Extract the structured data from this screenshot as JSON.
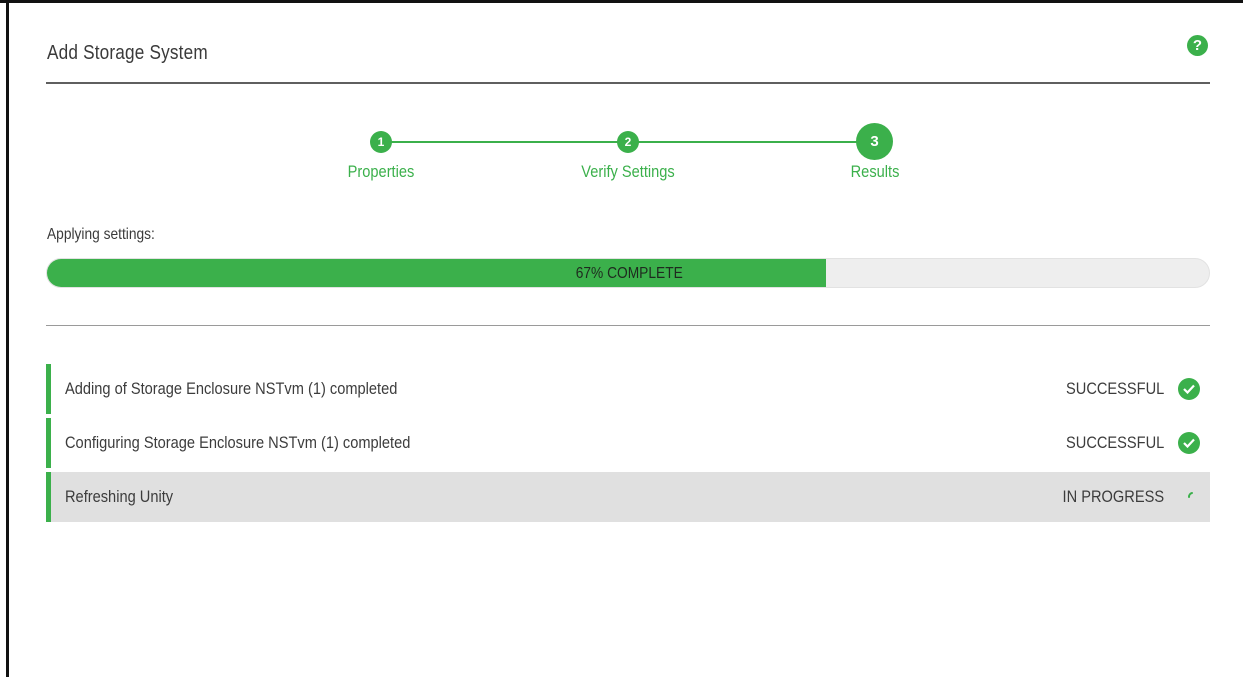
{
  "dialog": {
    "title": "Add Storage System"
  },
  "icons": {
    "help": "help-icon",
    "check": "check-circle-icon",
    "spinner": "spinner-icon"
  },
  "colors": {
    "accent": "#3bb04b",
    "active_row_bg": "#e0e0e0"
  },
  "wizard": {
    "steps": [
      {
        "number": "1",
        "label": "Properties"
      },
      {
        "number": "2",
        "label": "Verify Settings"
      },
      {
        "number": "3",
        "label": "Results"
      }
    ],
    "current_step": 3
  },
  "progress": {
    "label": "Applying settings:",
    "percent": 67,
    "text": "67% COMPLETE"
  },
  "results": [
    {
      "text": "Adding of Storage Enclosure NSTvm (1) completed",
      "status": "SUCCESSFUL",
      "state": "done"
    },
    {
      "text": "Configuring Storage Enclosure NSTvm (1) completed",
      "status": "SUCCESSFUL",
      "state": "done"
    },
    {
      "text": "Refreshing Unity",
      "status": "IN PROGRESS",
      "state": "in-progress"
    }
  ]
}
